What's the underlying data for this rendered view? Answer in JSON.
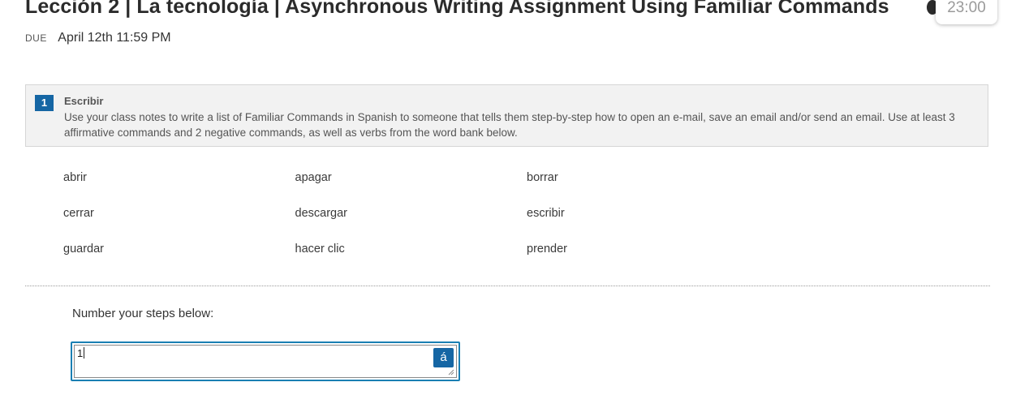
{
  "header": {
    "title": "Lección 2 | La tecnología | Asynchronous Writing Assignment Using Familiar Commands",
    "timer": "23:00",
    "due_label": "DUE",
    "due_date": "April 12th 11:59 PM"
  },
  "instructions": {
    "step_number": "1",
    "heading": "Escribir",
    "body": "Use your class notes to write a list of Familiar Commands in Spanish to someone that tells them step-by-step how to open an e-mail, save an email and/or send an email. Use at least 3 affirmative commands and 2 negative commands, as well as verbs from the word bank below."
  },
  "word_bank": {
    "rows": [
      [
        "abrir",
        "apagar",
        "borrar"
      ],
      [
        "cerrar",
        "descargar",
        "escribir"
      ],
      [
        "guardar",
        "hacer clic",
        "prender"
      ]
    ]
  },
  "response": {
    "label": "Number your steps below:",
    "value": "1",
    "accent_button_label": "á"
  },
  "colors": {
    "accent": "#1566a4",
    "focus_border": "#1a7fb3",
    "panel_bg": "#f2f2f2"
  }
}
